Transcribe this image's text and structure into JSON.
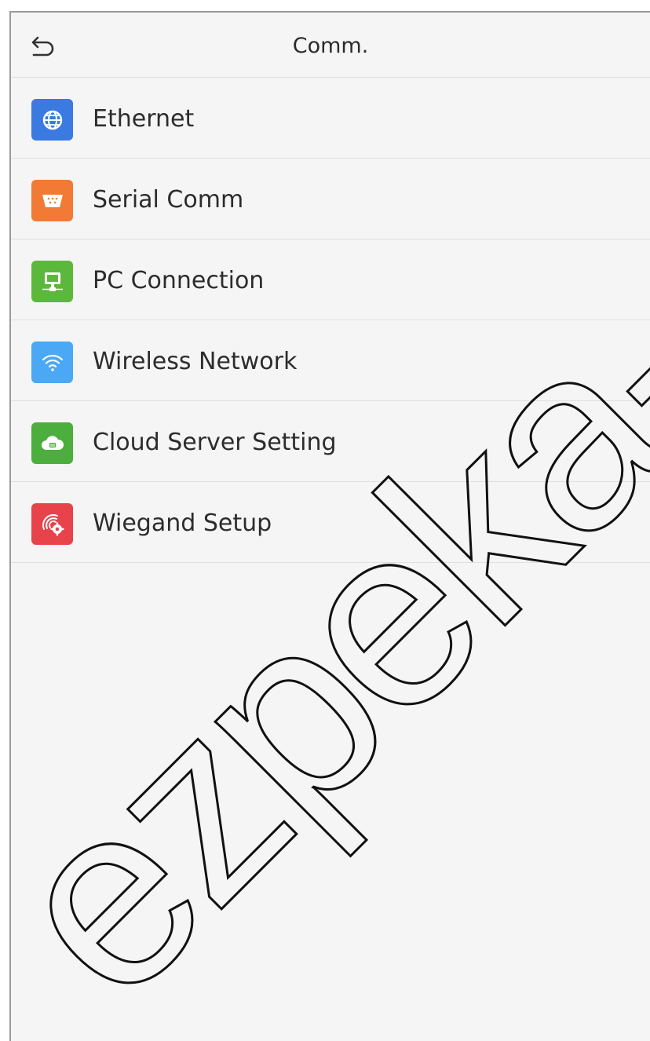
{
  "header": {
    "title": "Comm.",
    "back_icon": "back-arrow-icon"
  },
  "menu": {
    "items": [
      {
        "label": "Ethernet",
        "icon": "globe-icon",
        "color": "#3b7ae0"
      },
      {
        "label": "Serial Comm",
        "icon": "serial-port-icon",
        "color": "#f27a35"
      },
      {
        "label": "PC Connection",
        "icon": "pc-monitor-icon",
        "color": "#5cb83c"
      },
      {
        "label": "Wireless Network",
        "icon": "wifi-icon",
        "color": "#4aa8f5"
      },
      {
        "label": "Cloud Server Setting",
        "icon": "cloud-icon",
        "color": "#4cae3c"
      },
      {
        "label": "Wiegand Setup",
        "icon": "wiegand-gear-icon",
        "color": "#e8424a"
      }
    ]
  },
  "watermark": {
    "text": "ezpeka-sho"
  }
}
